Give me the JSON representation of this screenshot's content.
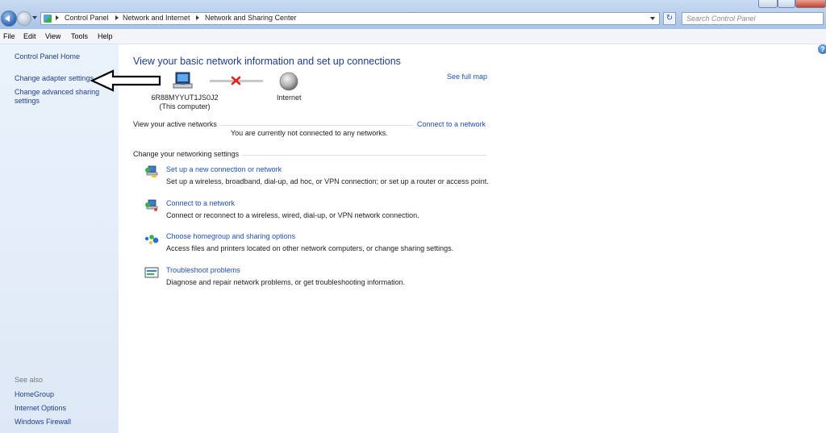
{
  "address": {
    "crumbs": [
      "Control Panel",
      "Network and Internet",
      "Network and Sharing Center"
    ],
    "search_placeholder": "Search Control Panel"
  },
  "menu": [
    "File",
    "Edit",
    "View",
    "Tools",
    "Help"
  ],
  "left_pane": {
    "links": [
      "Control Panel Home",
      "Change adapter settings",
      "Change advanced sharing settings"
    ],
    "see_also_label": "See also",
    "see_also": [
      "HomeGroup",
      "Internet Options",
      "Windows Firewall"
    ]
  },
  "main": {
    "title": "View your basic network information and set up connections",
    "see_full_map": "See full map",
    "computer_name": "6R88MYYUT1JS0J2",
    "computer_sub": "(This computer)",
    "internet_label": "Internet",
    "active_networks_label": "View your active networks",
    "not_connected": "You are currently not connected to any networks.",
    "connect_link": "Connect to a network",
    "change_settings_label": "Change your networking settings",
    "tasks": [
      {
        "title": "Set up a new connection or network",
        "desc": "Set up a wireless, broadband, dial-up, ad hoc, or VPN connection; or set up a router or access point.",
        "icon": "new-connection-icon"
      },
      {
        "title": "Connect to a network",
        "desc": "Connect or reconnect to a wireless, wired, dial-up, or VPN network connection.",
        "icon": "connect-network-icon"
      },
      {
        "title": "Choose homegroup and sharing options",
        "desc": "Access files and printers located on other network computers, or change sharing settings.",
        "icon": "homegroup-icon"
      },
      {
        "title": "Troubleshoot problems",
        "desc": "Diagnose and repair network problems, or get troubleshooting information.",
        "icon": "troubleshoot-icon"
      }
    ]
  },
  "colors": {
    "link": "#1f4fb5",
    "title": "#1e3c8a",
    "left_pane_bg": "#e3ecf8",
    "disconnect_x": "#e0251f"
  }
}
